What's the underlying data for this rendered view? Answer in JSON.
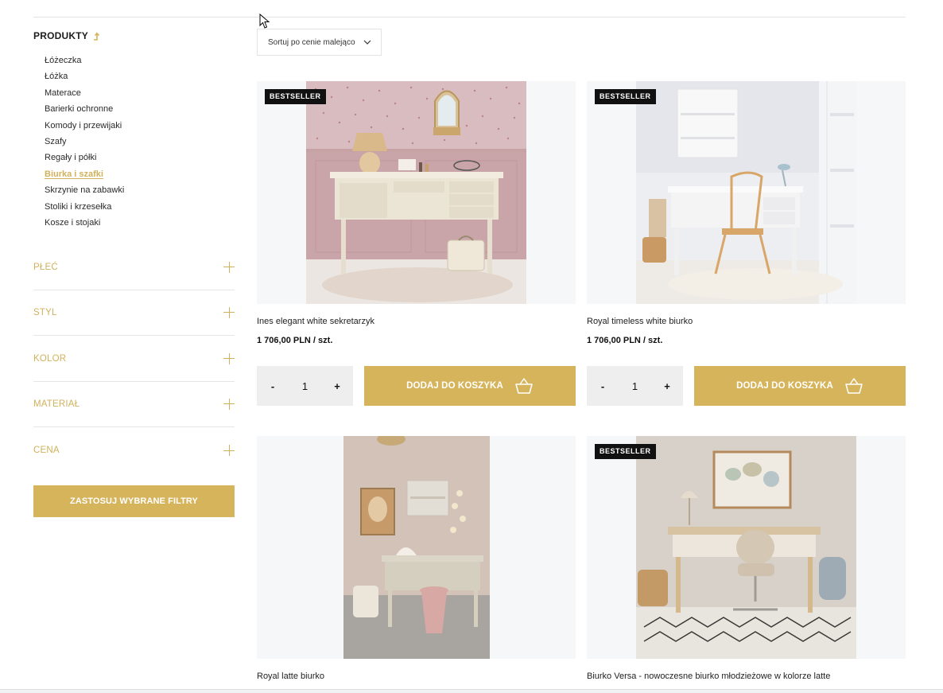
{
  "sidebar": {
    "title": "PRODUKTY",
    "categories": [
      {
        "label": "Łóżeczka"
      },
      {
        "label": "Łóżka"
      },
      {
        "label": "Materace"
      },
      {
        "label": "Barierki ochronne"
      },
      {
        "label": "Komody i przewijaki"
      },
      {
        "label": "Szafy"
      },
      {
        "label": "Regały i półki"
      },
      {
        "label": "Biurka i szafki",
        "active": true
      },
      {
        "label": "Skrzynie na zabawki"
      },
      {
        "label": "Stoliki i krzesełka"
      },
      {
        "label": "Kosze i stojaki"
      }
    ],
    "filters": [
      {
        "label": "PŁEĆ"
      },
      {
        "label": "STYL"
      },
      {
        "label": "KOLOR"
      },
      {
        "label": "MATERIAŁ"
      },
      {
        "label": "CENA"
      }
    ],
    "apply_label": "ZASTOSUJ WYBRANE FILTRY"
  },
  "sort": {
    "label": "Sortuj po cenie malejąco"
  },
  "products": [
    {
      "badge": "BESTSELLER",
      "name": "Ines elegant white sekretarzyk",
      "price": "1 706,00 PLN / szt.",
      "qty": "1",
      "minus": "-",
      "plus": "+",
      "add_label": "DODAJ DO KOSZYKA"
    },
    {
      "badge": "BESTSELLER",
      "name": "Royal timeless white biurko",
      "price": "1 706,00 PLN / szt.",
      "qty": "1",
      "minus": "-",
      "plus": "+",
      "add_label": "DODAJ DO KOSZYKA"
    },
    {
      "badge": "",
      "name": "Royal latte biurko"
    },
    {
      "badge": "BESTSELLER",
      "name": "Biurko Versa - nowoczesne biurko młodzieżowe w kolorze latte"
    }
  ],
  "colors": {
    "accent": "#d6b45c",
    "badge_bg": "#111111",
    "qty_bg": "#eeeeee",
    "image_bg": "#f6f7f9"
  }
}
